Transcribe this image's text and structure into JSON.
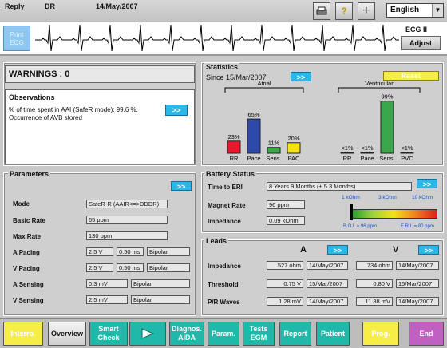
{
  "top": {
    "mode": "Reply",
    "device": "DR",
    "date": "14/May/2007",
    "language": "English"
  },
  "ecg": {
    "print_label": "Print ECG",
    "lead": "ECG II",
    "adjust_label": "Adjust"
  },
  "warnings": {
    "title": "WARNINGS : 0"
  },
  "observations": {
    "title": "Observations",
    "line1": "% of time spent in AAI (SafeR mode): 99.6 %.",
    "line2": "Occurrence of AVB stored",
    "more_label": ">>"
  },
  "statistics": {
    "title": "Statistics",
    "since": "Since 15/Mar/2007",
    "more_label": ">>",
    "reset_label": "Reset",
    "atrial_label": "Atrial",
    "ventricular_label": "Ventricular",
    "atrial": [
      {
        "label": "RR",
        "value": "23%",
        "pct": 23,
        "color": "#e8192c"
      },
      {
        "label": "Pace",
        "value": "65%",
        "pct": 65,
        "color": "#2e4aa8"
      },
      {
        "label": "Sens.",
        "value": "11%",
        "pct": 11,
        "color": "#3aa84a"
      },
      {
        "label": "PAC",
        "value": "20%",
        "pct": 20,
        "color": "#f2e21a"
      }
    ],
    "ventricular": [
      {
        "label": "RR",
        "value": "<1%",
        "pct": 0.5,
        "color": "#e8192c"
      },
      {
        "label": "Pace",
        "value": "<1%",
        "pct": 0.5,
        "color": "#2e4aa8"
      },
      {
        "label": "Sens.",
        "value": "99%",
        "pct": 99,
        "color": "#3aa84a"
      },
      {
        "label": "PVC",
        "value": "<1%",
        "pct": 0.5,
        "color": "#f2e21a"
      }
    ]
  },
  "parameters": {
    "title": "Parameters",
    "more_label": ">>",
    "mode_label": "Mode",
    "mode": "SafeR-R (AAIR<=>DDDR)",
    "basic_rate_label": "Basic Rate",
    "basic_rate": "65 ppm",
    "max_rate_label": "Max Rate",
    "max_rate": "130 ppm",
    "a_pacing_label": "A Pacing",
    "a_pacing_amp": "2.5 V",
    "a_pacing_width": "0.50 ms",
    "a_pacing_pol": "Bipolar",
    "v_pacing_label": "V Pacing",
    "v_pacing_amp": "2.5 V",
    "v_pacing_width": "0.50 ms",
    "v_pacing_pol": "Bipolar",
    "a_sensing_label": "A Sensing",
    "a_sensing": "0.3 mV",
    "a_sensing_pol": "Bipolar",
    "v_sensing_label": "V Sensing",
    "v_sensing": "2.5 mV",
    "v_sensing_pol": "Bipolar"
  },
  "battery": {
    "title": "Battery Status",
    "more_label": ">>",
    "eri_label": "Time to ERI",
    "eri": "8 Years 9 Months (± 5.3 Months)",
    "magnet_label": "Magnet Rate",
    "magnet": "96 ppm",
    "impedance_label": "Impedance",
    "impedance": "0.09 kOhm",
    "scale": [
      "1 kOhm",
      "3 kOhm",
      "10 kOhm"
    ],
    "bol": "B.O.L = 96 ppm",
    "eri_note": "E.R.I. = 80 ppm"
  },
  "leads": {
    "title": "Leads",
    "a_label": "A",
    "v_label": "V",
    "more_label": ">>",
    "impedance_label": "Impedance",
    "threshold_label": "Threshold",
    "pr_label": "P/R Waves",
    "a_impedance": "527 ohm",
    "a_impedance_date": "14/May/2007",
    "v_impedance": "734 ohm",
    "v_impedance_date": "14/May/2007",
    "a_threshold": "0.75 V",
    "a_threshold_date": "15/Mar/2007",
    "v_threshold": "0.80 V",
    "v_threshold_date": "15/Mar/2007",
    "a_pr": "1.28 mV",
    "a_pr_date": "14/May/2007",
    "v_pr": "11.88 mV",
    "v_pr_date": "14/May/2007"
  },
  "nav": {
    "interro": "Interro.",
    "overview": "Overview",
    "smart_check": "Smart Check",
    "diagnos": "Diagnos. AIDA",
    "param": "Param.",
    "tests": "Tests EGM",
    "report": "Report",
    "patient": "Patient",
    "prog": "Prog.",
    "end": "End"
  }
}
